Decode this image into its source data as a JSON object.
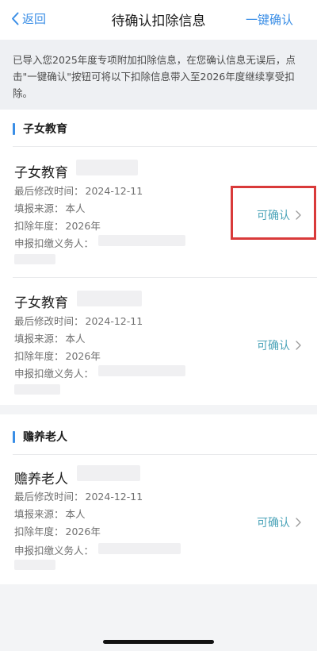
{
  "nav": {
    "back_label": "返回",
    "title": "待确认扣除信息",
    "action_label": "一键确认"
  },
  "notice": {
    "text": "已导入您2025年度专项附加扣除信息，在您确认信息无误后，点击\"一键确认\"按钮可将以下扣除信息带入至2026年度继续享受扣除。"
  },
  "sections": [
    {
      "title": "子女教育",
      "cards": [
        {
          "name": "子女教育",
          "fields": [
            {
              "label": "最后修改时间：",
              "value": "2024-12-11"
            },
            {
              "label": "填报来源：",
              "value": "本人"
            },
            {
              "label": "扣除年度：",
              "value": "2026年"
            },
            {
              "label": "申报扣缴义务人：",
              "value": ""
            }
          ],
          "confirm_label": "可确认"
        },
        {
          "name": "子女教育",
          "fields": [
            {
              "label": "最后修改时间：",
              "value": "2024-12-11"
            },
            {
              "label": "填报来源：",
              "value": "本人"
            },
            {
              "label": "扣除年度：",
              "value": "2026年"
            },
            {
              "label": "申报扣缴义务人：",
              "value": ""
            }
          ],
          "confirm_label": "可确认"
        }
      ]
    },
    {
      "title": "赡养老人",
      "cards": [
        {
          "name": "赡养老人",
          "fields": [
            {
              "label": "最后修改时间：",
              "value": "2024-12-11"
            },
            {
              "label": "填报来源：",
              "value": "本人"
            },
            {
              "label": "扣除年度：",
              "value": "2026年"
            },
            {
              "label": "申报扣缴义务人：",
              "value": ""
            }
          ],
          "confirm_label": "可确认"
        }
      ]
    }
  ],
  "colors": {
    "accent": "#3a8ee6",
    "confirm": "#4aa3b8",
    "highlight": "#d93a3a"
  }
}
